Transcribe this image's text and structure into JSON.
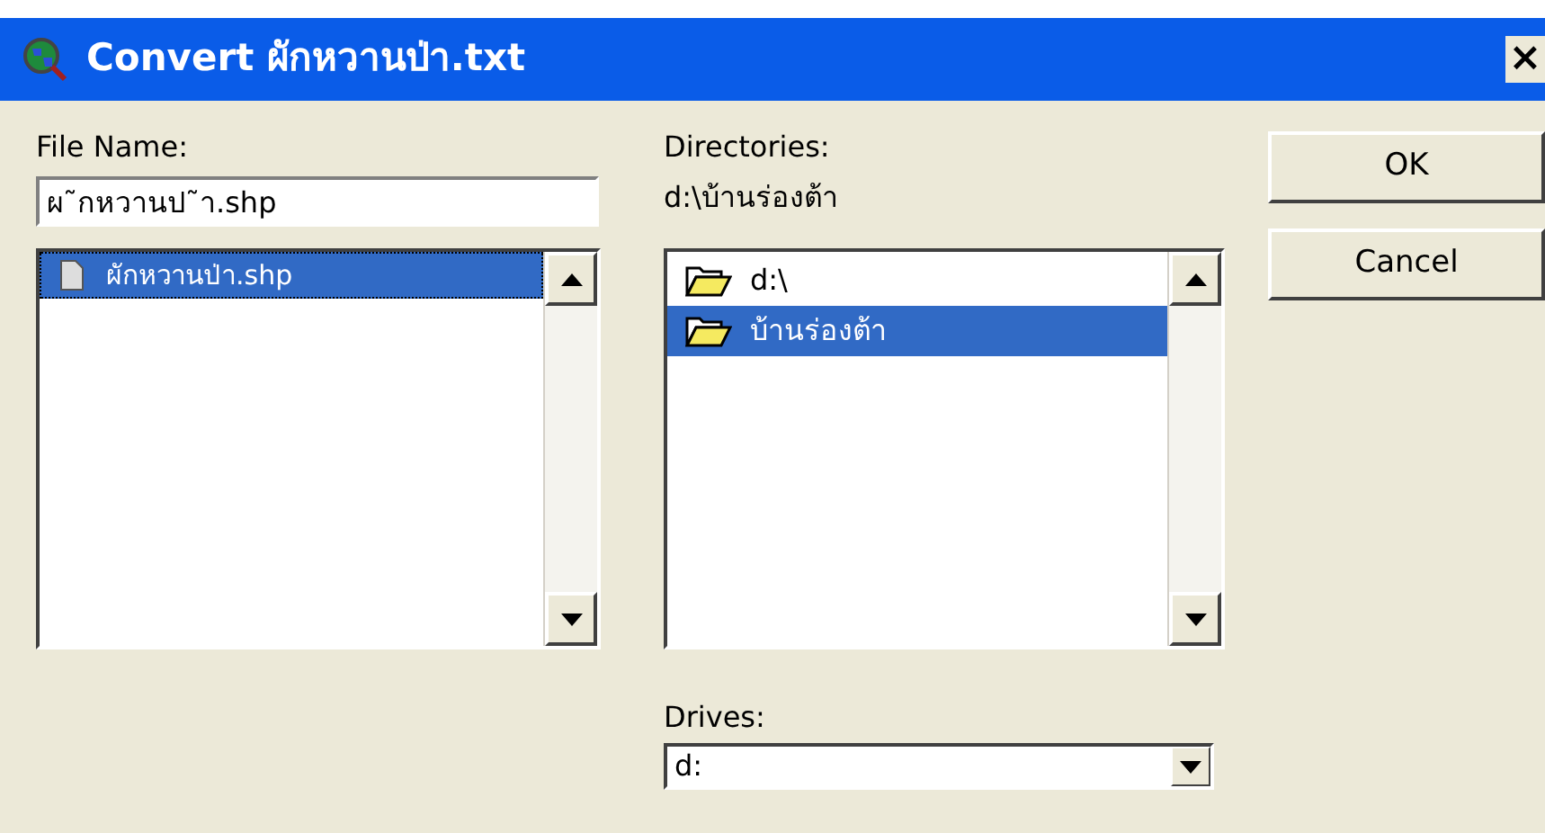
{
  "window": {
    "title": "Convert ผักหวานป่า.txt",
    "close": "×"
  },
  "file_name": {
    "label": "File Name:",
    "value": "ผ˜กหวานป˜า.shp"
  },
  "files": [
    {
      "name": "ผักหวานป่า.shp",
      "selected": true
    }
  ],
  "directories": {
    "label": "Directories:",
    "path": "d:\\บ้านร่องต้า",
    "items": [
      {
        "name": "d:\\",
        "selected": false
      },
      {
        "name": "บ้านร่องต้า",
        "selected": true
      }
    ]
  },
  "drives": {
    "label": "Drives:",
    "value": "d:"
  },
  "buttons": [
    "OK",
    "Cancel"
  ]
}
